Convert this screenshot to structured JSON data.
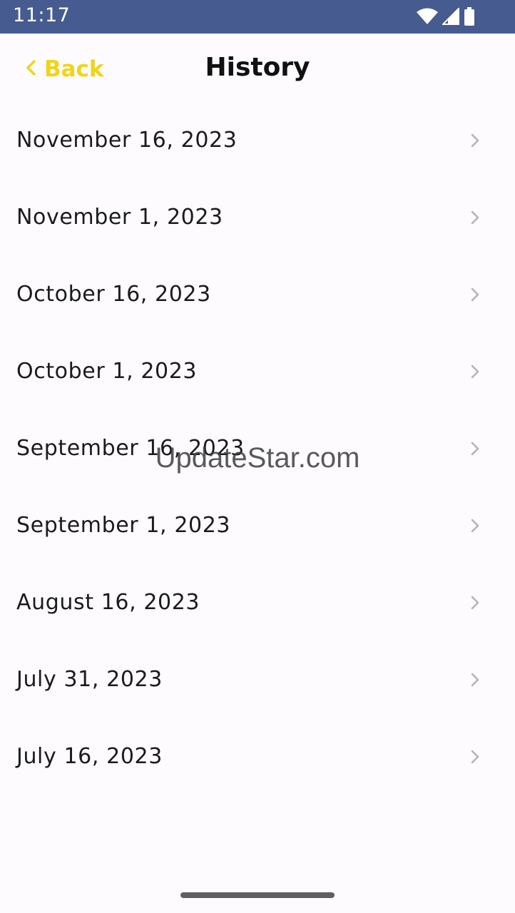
{
  "status_bar": {
    "time": "11:17",
    "icons": [
      "wifi-icon",
      "cellular-signal-icon",
      "battery-icon"
    ],
    "background": "#465b8f"
  },
  "nav": {
    "back_label": "Back",
    "title": "History",
    "accent": "#f0d418"
  },
  "history": {
    "items": [
      {
        "label": "November 16, 2023"
      },
      {
        "label": "November 1, 2023"
      },
      {
        "label": "October 16, 2023"
      },
      {
        "label": "October 1, 2023"
      },
      {
        "label": "September 16, 2023"
      },
      {
        "label": "September 1, 2023"
      },
      {
        "label": "August 16, 2023"
      },
      {
        "label": "July 31, 2023"
      },
      {
        "label": "July 16, 2023"
      }
    ]
  },
  "watermark": "UpdateStar.com"
}
